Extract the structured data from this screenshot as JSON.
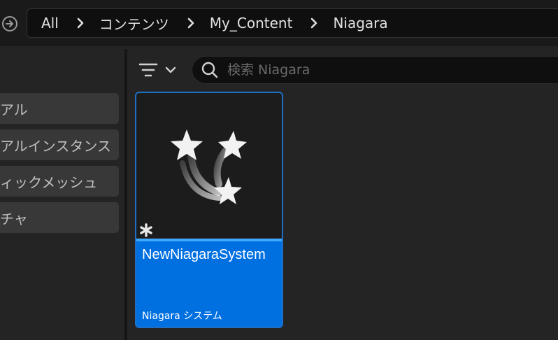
{
  "breadcrumb": {
    "items": [
      "All",
      "コンテンツ",
      "My_Content",
      "Niagara"
    ]
  },
  "filters": {
    "items": [
      "アル",
      "アルインスタンス",
      "ィックメッシュ",
      "チャ"
    ]
  },
  "search": {
    "placeholder": "検索 Niagara"
  },
  "asset": {
    "name": "NewNiagaraSystem",
    "type": "Niagara システム",
    "icon": "niagara-system-icon"
  },
  "colors": {
    "selection": "#0070e0",
    "accent": "#3fa9ff",
    "background": "#242424"
  }
}
